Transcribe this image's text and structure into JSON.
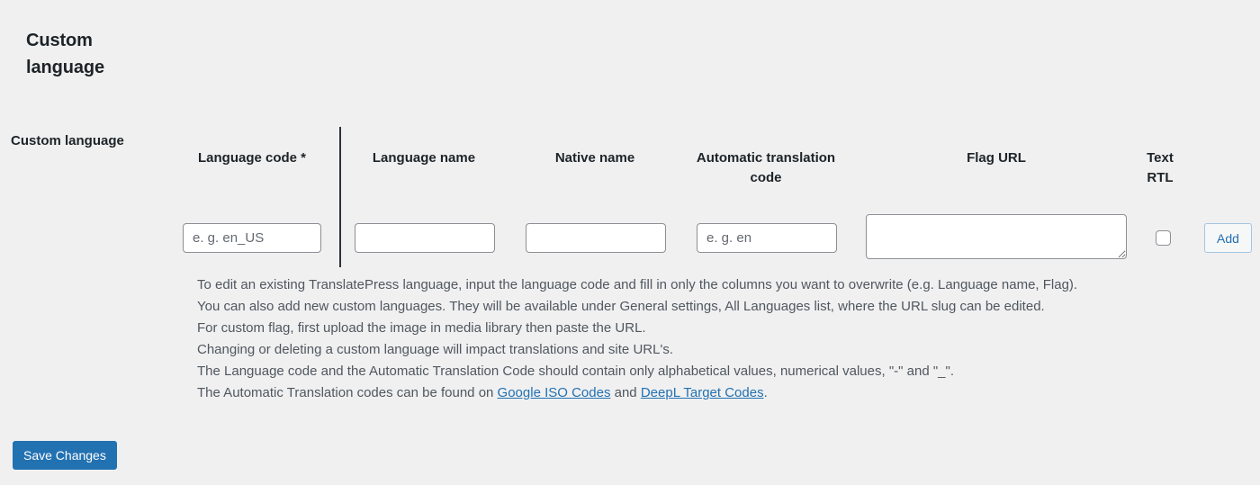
{
  "page": {
    "title": "Custom language",
    "row_label": "Custom language"
  },
  "columns": {
    "language_code": "Language code *",
    "language_name": "Language name",
    "native_name": "Native name",
    "automatic_translation_code": "Automatic translation code",
    "flag_url": "Flag URL",
    "text_rtl": "Text RTL"
  },
  "fields": {
    "language_code": {
      "value": "",
      "placeholder": "e. g. en_US"
    },
    "language_name": {
      "value": "",
      "placeholder": ""
    },
    "native_name": {
      "value": "",
      "placeholder": ""
    },
    "automatic_translation_code": {
      "value": "",
      "placeholder": "e. g. en"
    },
    "flag_url": {
      "value": "",
      "placeholder": ""
    },
    "text_rtl": {
      "checked": false
    }
  },
  "buttons": {
    "add": "Add",
    "save": "Save Changes"
  },
  "description": {
    "line1": "To edit an existing TranslatePress language, input the language code and fill in only the columns you want to overwrite (e.g. Language name, Flag).",
    "line2": "You can also add new custom languages. They will be available under General settings, All Languages list, where the URL slug can be edited.",
    "line3": "For custom flag, first upload the image in media library then paste the URL.",
    "line4": "Changing or deleting a custom language will impact translations and site URL's.",
    "line5": "The Language code and the Automatic Translation Code should contain only alphabetical values, numerical values, \"-\" and \"_\".",
    "line6_prefix": "The Automatic Translation codes can be found on ",
    "link_google": "Google ISO Codes",
    "line6_middle": " and ",
    "link_deepl": "DeepL Target Codes",
    "line6_suffix": "."
  },
  "colors": {
    "background": "#f0f0f1",
    "accent": "#2271b1",
    "text": "#1d2327",
    "muted_text": "#50575e",
    "border": "#8c8f94",
    "divider": "#2c3338"
  }
}
